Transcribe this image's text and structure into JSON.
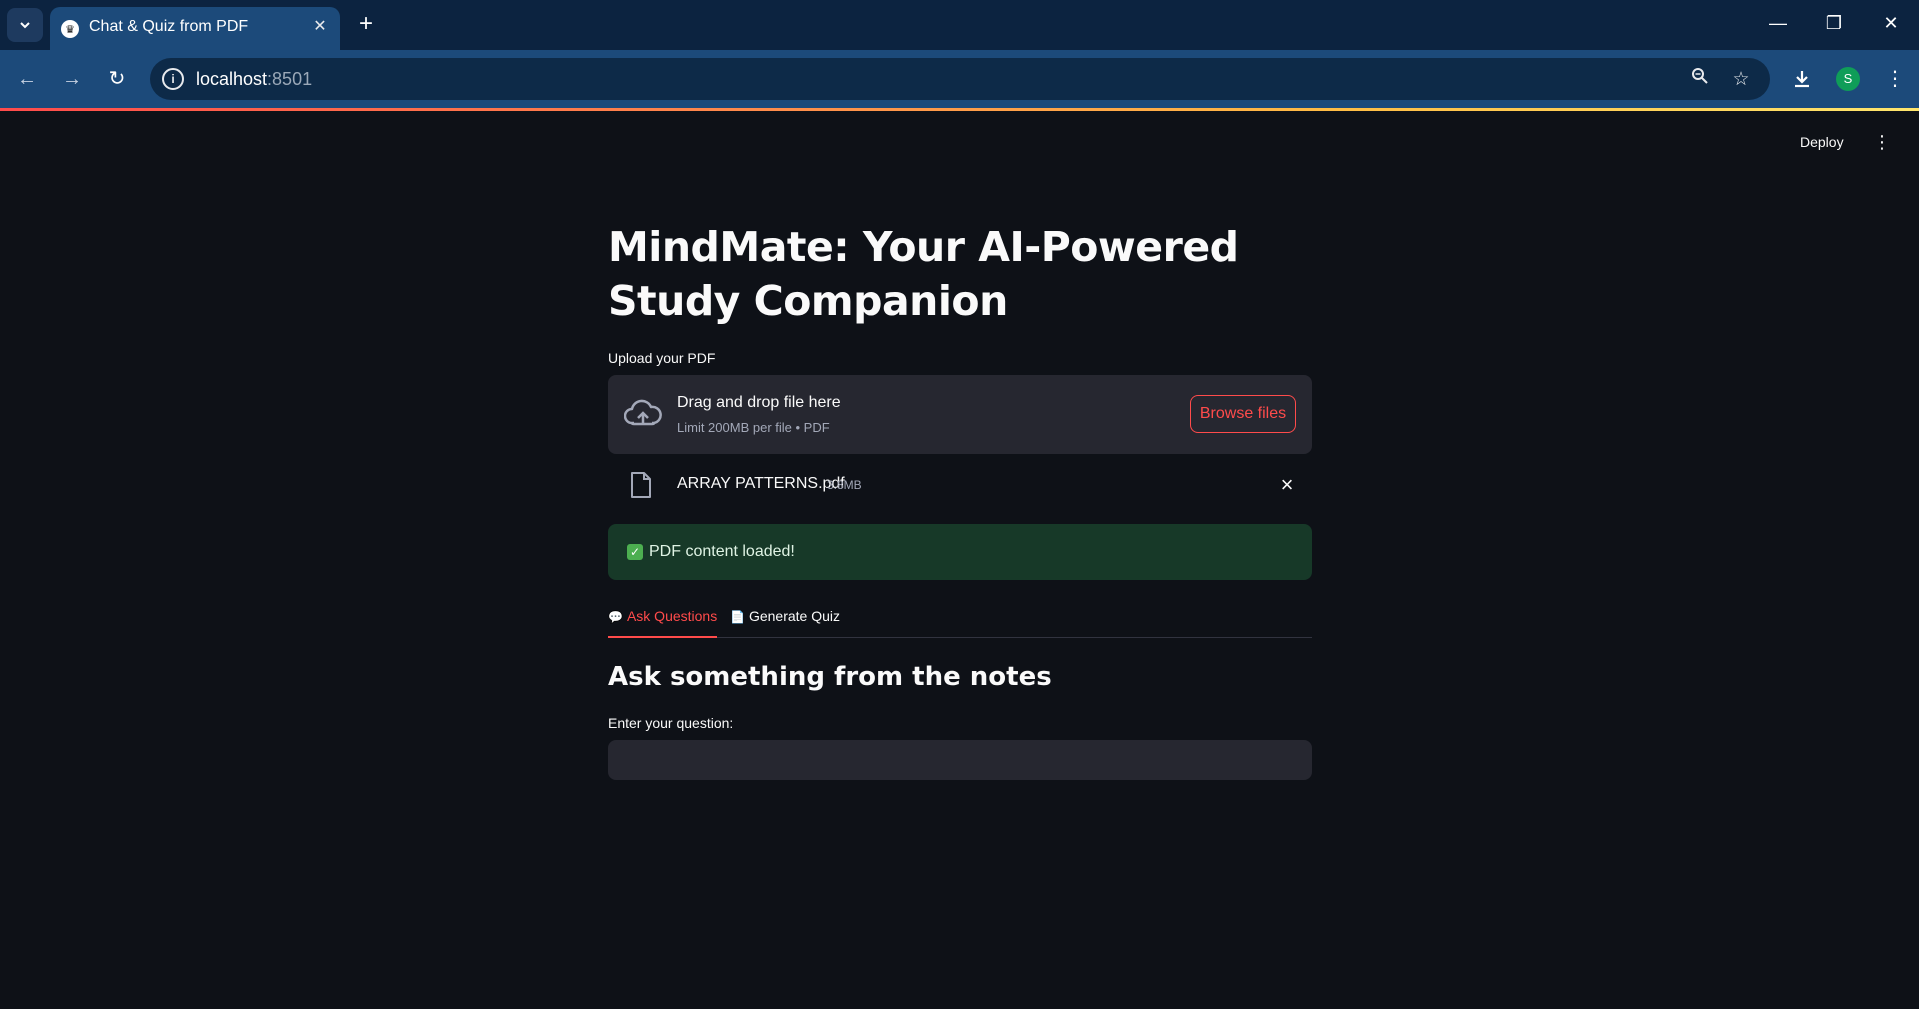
{
  "browser": {
    "tab_title": "Chat & Quiz from PDF",
    "url_host": "localhost",
    "url_port": ":8501",
    "profile_initial": "S"
  },
  "header": {
    "deploy_label": "Deploy"
  },
  "main": {
    "title": "MindMate: Your AI-Powered Study Companion",
    "upload": {
      "label": "Upload your PDF",
      "drop_title": "Drag and drop file here",
      "drop_sub": "Limit 200MB per file • PDF",
      "browse_label": "Browse files"
    },
    "file": {
      "name": "ARRAY PATTERNS.pdf",
      "size": "3.8MB"
    },
    "success_message": "PDF content loaded!",
    "tabs": [
      {
        "emoji": "💬",
        "label": "Ask Questions",
        "active": true
      },
      {
        "emoji": "📄",
        "label": "Generate Quiz",
        "active": false
      }
    ],
    "section_title": "Ask something from the notes",
    "question_label": "Enter your question:",
    "question_value": ""
  },
  "colors": {
    "accent": "#ff4b4b",
    "background": "#0e1117",
    "surface": "#262730",
    "success_bg": "#173928"
  }
}
